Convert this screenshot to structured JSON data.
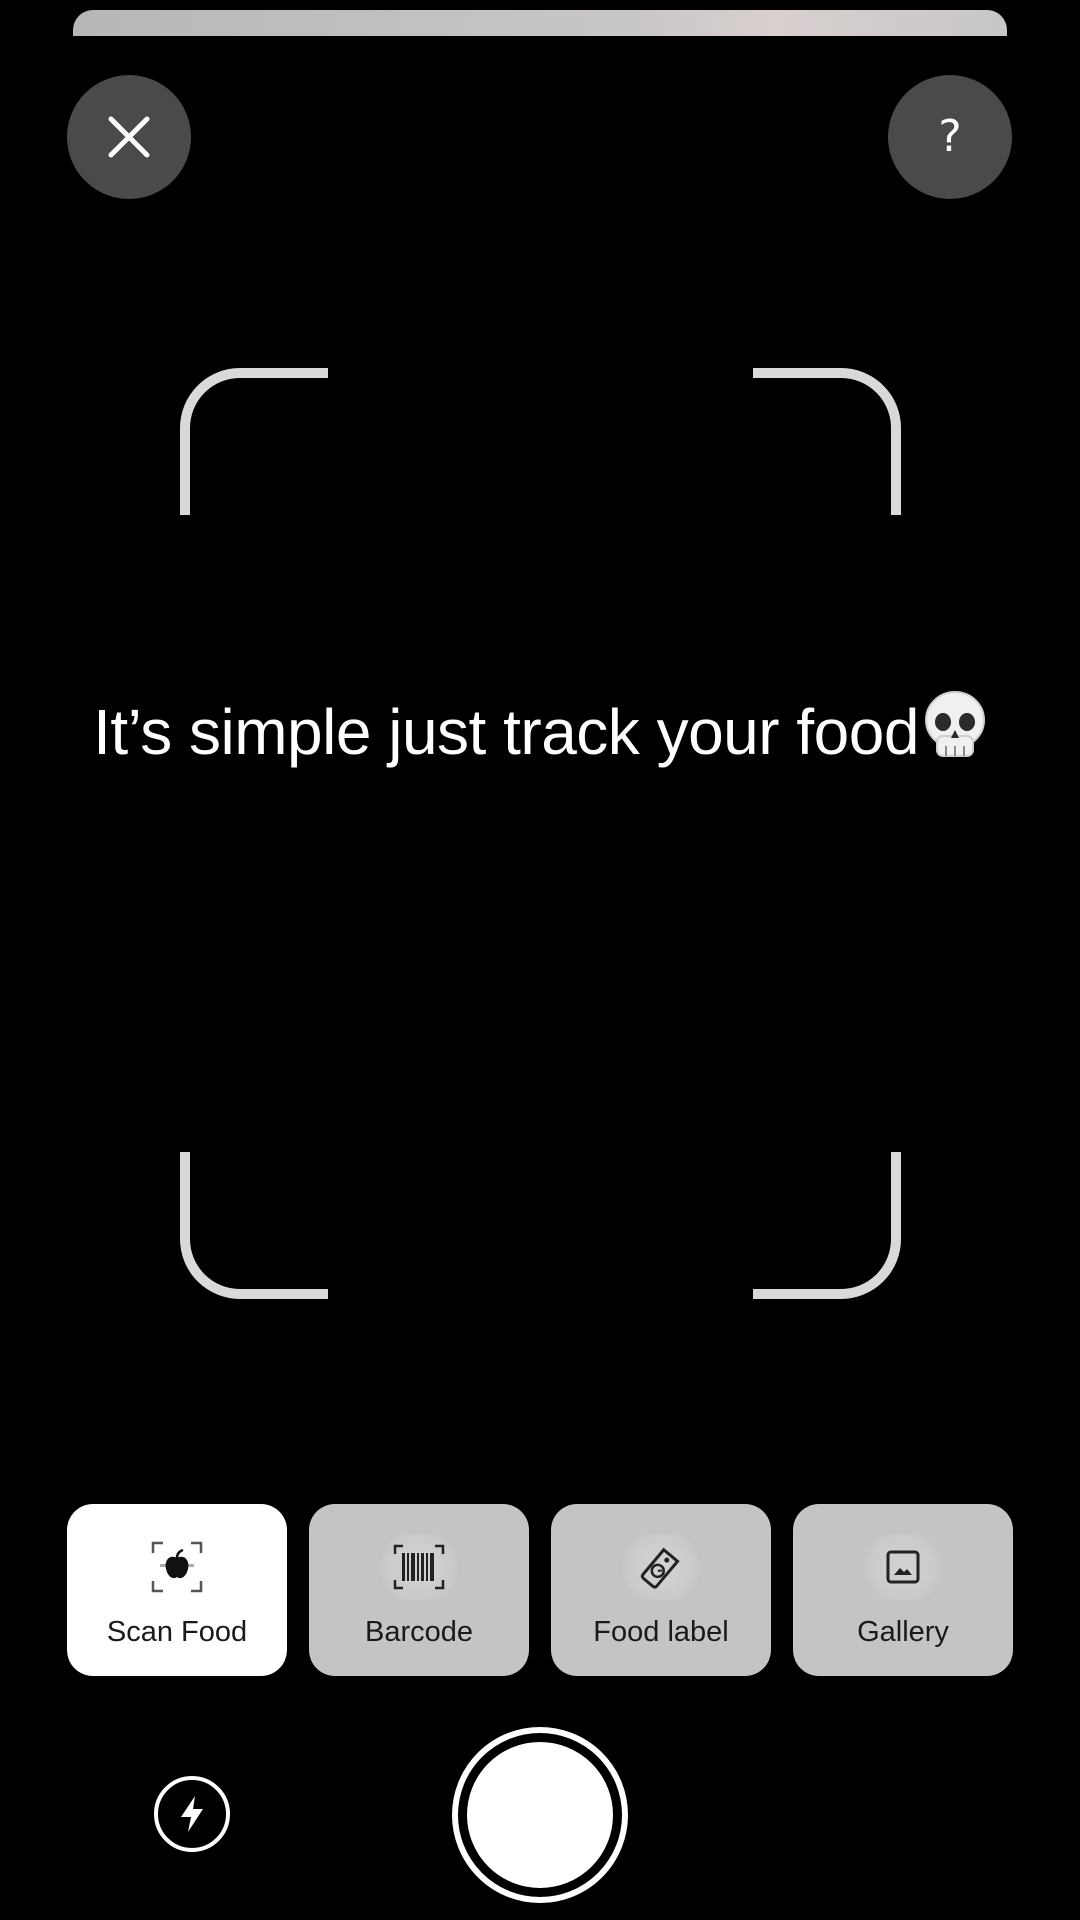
{
  "top_bar": {
    "close_icon": "close-icon",
    "help_label": "?"
  },
  "viewfinder": {
    "icon": "scan-frame-corners",
    "color": "#d9d9d9"
  },
  "caption": {
    "text": "It’s simple just track your food",
    "emoji": "skull-emoji"
  },
  "modes": [
    {
      "label": "Scan Food",
      "icon": "scan-food-icon",
      "active": true
    },
    {
      "label": "Barcode",
      "icon": "barcode-icon",
      "active": false
    },
    {
      "label": "Food label",
      "icon": "food-label-icon",
      "active": false
    },
    {
      "label": "Gallery",
      "icon": "gallery-icon",
      "active": false
    }
  ],
  "controls": {
    "flash_icon": "flash-icon",
    "shutter": "shutter-button"
  },
  "colors": {
    "background": "#000000",
    "button_dark": "#4a4a4a",
    "mode_inactive": "#c4c4c4",
    "mode_active": "#ffffff"
  }
}
